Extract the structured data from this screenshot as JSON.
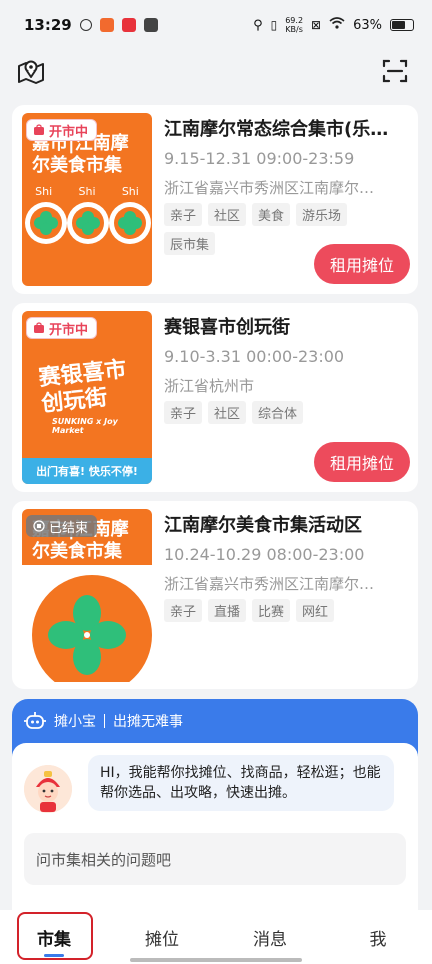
{
  "status": {
    "time": "13:29",
    "speed_value": "69.2",
    "speed_unit": "KB/s",
    "battery": "63%"
  },
  "cards": [
    {
      "badge": "开市中",
      "title": "江南摩尔常态综合集市(乐…",
      "time": "9.15-12.31 09:00-23:59",
      "address": "浙江省嘉兴市秀洲区江南摩尔…",
      "tags": [
        "亲子",
        "社区",
        "美食",
        "游乐场",
        "辰市集"
      ],
      "button": "租用摊位",
      "thumb_text": "嘉市|江南摩尔美食市集",
      "thumb_shi": [
        "Shi",
        "Shi",
        "Shi"
      ]
    },
    {
      "badge": "开市中",
      "title": "赛银喜市创玩街",
      "time": "9.10-3.31 00:00-23:00",
      "address": "浙江省杭州市",
      "tags": [
        "亲子",
        "社区",
        "综合体"
      ],
      "button": "租用摊位",
      "thumb_text": "赛银喜市创玩街",
      "thumb_sub": "SUNKING x Joy Market",
      "thumb_bar": "出门有喜! 快乐不停!"
    },
    {
      "badge": "已结束",
      "title": "江南摩尔美食市集活动区",
      "time": "10.24-10.29 08:00-23:00",
      "address": "浙江省嘉兴市秀洲区江南摩尔…",
      "tags": [
        "亲子",
        "直播",
        "比赛",
        "网红"
      ],
      "thumb_text": "嘉市|江南摩尔美食市集"
    }
  ],
  "assistant": {
    "name": "摊小宝",
    "slogan": "出摊无难事",
    "message": "HI，我能帮你找摊位、找商品，轻松逛；也能帮你选品、出攻略，快速出摊。",
    "input_placeholder": "问市集相关的问题吧"
  },
  "tabs": [
    "市集",
    "摊位",
    "消息",
    "我"
  ],
  "colors": {
    "accent": "#ed4b5c",
    "brand_blue": "#3a7bea",
    "orange": "#f37521"
  }
}
